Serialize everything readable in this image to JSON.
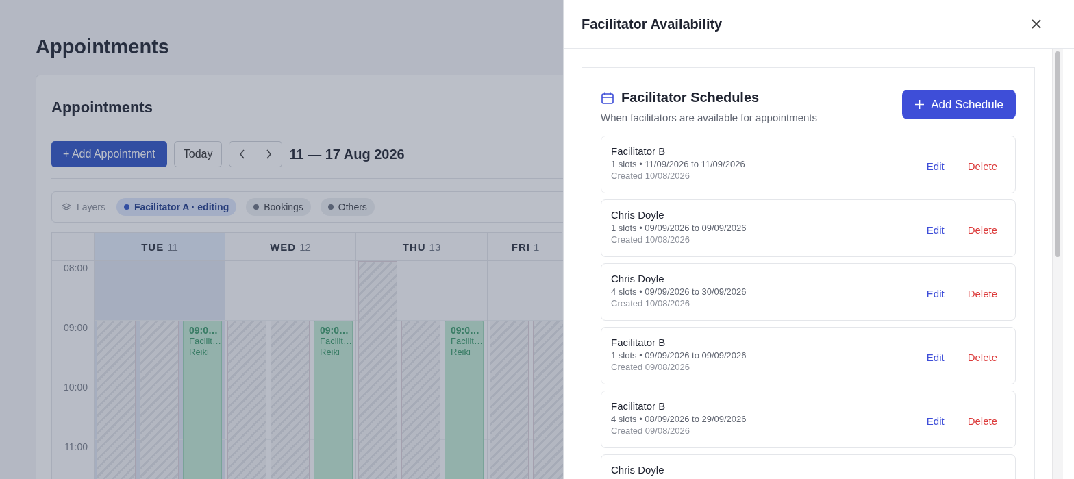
{
  "page": {
    "title": "Appointments"
  },
  "card": {
    "title": "Appointments",
    "add_button": "+ Add Appointment",
    "today_button": "Today",
    "date_range": "11 — 17 Aug 2026"
  },
  "layers": {
    "label": "Layers",
    "chips": [
      {
        "label": "Facilitator A · editing",
        "selected": true
      },
      {
        "label": "Bookings",
        "selected": false
      },
      {
        "label": "Others",
        "selected": false
      }
    ]
  },
  "calendar": {
    "times": [
      "08:00",
      "09:00",
      "10:00",
      "11:00"
    ],
    "days": [
      {
        "day": "TUE",
        "date": "11",
        "selected": true,
        "lanes": [
          {
            "kind": "blocked"
          },
          {
            "kind": "blocked"
          },
          {
            "kind": "event",
            "time": "09:0…",
            "facilitator": "Facilit…",
            "service": "Reiki"
          }
        ]
      },
      {
        "day": "WED",
        "date": "12",
        "selected": false,
        "lanes": [
          {
            "kind": "blocked"
          },
          {
            "kind": "blocked"
          },
          {
            "kind": "event",
            "time": "09:0…",
            "facilitator": "Facilit…",
            "service": "Reiki"
          }
        ]
      },
      {
        "day": "THU",
        "date": "13",
        "selected": false,
        "lanes": [
          {
            "kind": "blocked-full"
          },
          {
            "kind": "blocked"
          },
          {
            "kind": "event",
            "time": "09:0…",
            "facilitator": "Facilit…",
            "service": "Reiki"
          }
        ]
      },
      {
        "day": "FRI",
        "date": "1",
        "selected": false,
        "lanes": [
          {
            "kind": "blocked"
          },
          {
            "kind": "blocked"
          }
        ]
      }
    ]
  },
  "drawer": {
    "title": "Facilitator Availability",
    "section": {
      "title": "Facilitator Schedules",
      "subtitle": "When facilitators are available for appointments",
      "add_button": "Add Schedule",
      "schedules": [
        {
          "name": "Facilitator B",
          "details": "1 slots • 11/09/2026 to 11/09/2026",
          "created": "Created 10/08/2026",
          "edit": "Edit",
          "delete": "Delete"
        },
        {
          "name": "Chris Doyle",
          "details": "1 slots • 09/09/2026 to 09/09/2026",
          "created": "Created 10/08/2026",
          "edit": "Edit",
          "delete": "Delete"
        },
        {
          "name": "Chris Doyle",
          "details": "4 slots • 09/09/2026 to 30/09/2026",
          "created": "Created 10/08/2026",
          "edit": "Edit",
          "delete": "Delete"
        },
        {
          "name": "Facilitator B",
          "details": "1 slots • 09/09/2026 to 09/09/2026",
          "created": "Created 09/08/2026",
          "edit": "Edit",
          "delete": "Delete"
        },
        {
          "name": "Facilitator B",
          "details": "4 slots • 08/09/2026 to 29/09/2026",
          "created": "Created 09/08/2026",
          "edit": "Edit",
          "delete": "Delete"
        },
        {
          "name": "Chris Doyle"
        }
      ]
    }
  }
}
